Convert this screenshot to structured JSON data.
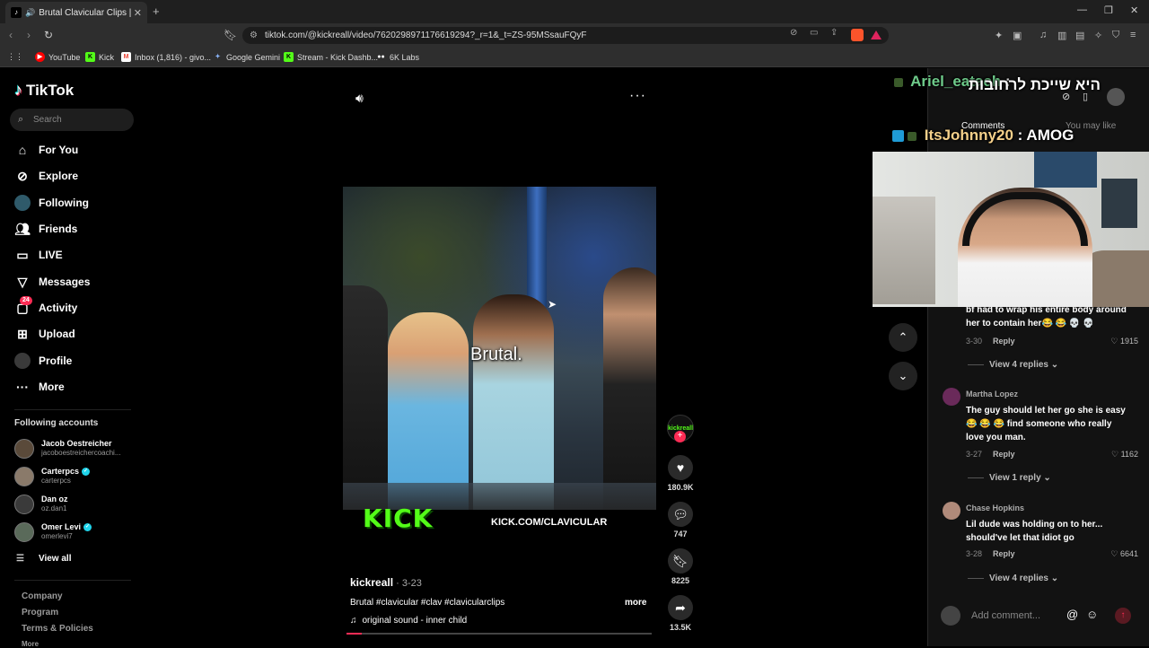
{
  "browser": {
    "tab_title": "Brutal Clavicular Clips | TikTok",
    "url": "tiktok.com/@kickreall/video/7620298971176619294?_r=1&_t=ZS-95MSsauFQyF",
    "bookmarks": [
      {
        "label": "YouTube",
        "color": "#ff0000"
      },
      {
        "label": "Kick",
        "color": "#53fc18"
      },
      {
        "label": "Inbox (1,816) - givo...",
        "color": "#ea4335"
      },
      {
        "label": "Google Gemini",
        "color": "#8ab4f8"
      },
      {
        "label": "Stream - Kick Dashb...",
        "color": "#53fc18"
      },
      {
        "label": "6K Labs",
        "color": "#ffffff"
      }
    ]
  },
  "sidebar": {
    "logo": "TikTok",
    "search_placeholder": "Search",
    "nav": [
      {
        "label": "For You",
        "icon": "home-icon"
      },
      {
        "label": "Explore",
        "icon": "compass-icon"
      },
      {
        "label": "Following",
        "icon": "avatar-icon"
      },
      {
        "label": "Friends",
        "icon": "friends-icon"
      },
      {
        "label": "LIVE",
        "icon": "live-icon"
      },
      {
        "label": "Messages",
        "icon": "messages-icon"
      },
      {
        "label": "Activity",
        "icon": "activity-icon",
        "badge": "24"
      },
      {
        "label": "Upload",
        "icon": "upload-icon"
      },
      {
        "label": "Profile",
        "icon": "profile-icon"
      },
      {
        "label": "More",
        "icon": "more-icon"
      }
    ],
    "following_title": "Following accounts",
    "accounts": [
      {
        "name": "Jacob Oestreicher",
        "handle": "jacoboestreichercoachi...",
        "verified": false
      },
      {
        "name": "Carterpcs",
        "handle": "carterpcs",
        "verified": true
      },
      {
        "name": "Dan oz",
        "handle": "oz.dan1",
        "verified": false
      },
      {
        "name": "Omer Levi",
        "handle": "omerlevi7",
        "verified": true
      }
    ],
    "view_all": "View all",
    "footer": [
      "Company",
      "Program",
      "Terms & Policies",
      "More"
    ]
  },
  "video": {
    "overlay_caption": "Brutal.",
    "kick_logo": "KICK",
    "kick_url": "KICK.COM/CLAVICULAR",
    "creator_badge": "kickreall",
    "author": "kickreall",
    "date": " · 3-23",
    "description": "Brutal #clavicular #clav #clavicularclips",
    "more_label": "more",
    "music": "original sound - inner child",
    "progress": 0.05
  },
  "actions": {
    "likes": "180.9K",
    "comments": "747",
    "saves": "8225",
    "shares": "13.5K"
  },
  "panel": {
    "tab_comments": "Comments",
    "tab_you_may_like": "You may like",
    "comments": [
      {
        "user": "",
        "text": "bf had to wrap his entire body around her to contain her😂 😂 💀 💀",
        "date": "3-30",
        "reply": "Reply",
        "likes": "1915",
        "view_replies": "View 4 replies"
      },
      {
        "user": "Martha Lopez",
        "text": "The guy should let her go she is easy 😂 😂 😂 find someone who really love you man.",
        "date": "3-27",
        "reply": "Reply",
        "likes": "1162",
        "view_replies": "View 1 reply"
      },
      {
        "user": "Chase Hopkins",
        "text": "Lil dude was holding on to her... should've let that idiot go",
        "date": "3-28",
        "reply": "Reply",
        "likes": "6641",
        "view_replies": "View 4 replies"
      }
    ],
    "input_placeholder": "Add comment..."
  },
  "stream_chat": [
    {
      "user": "Ariel_eatach",
      "message": "היא שייכת לרחובות",
      "color": "#6ecb8a"
    },
    {
      "user": "ItsJohnny20",
      "message": "AMOG",
      "color": "#f5d08a"
    }
  ],
  "colors": {
    "accent": "#fe2c55",
    "kick_green": "#53fc18",
    "verified": "#20d5ec"
  }
}
